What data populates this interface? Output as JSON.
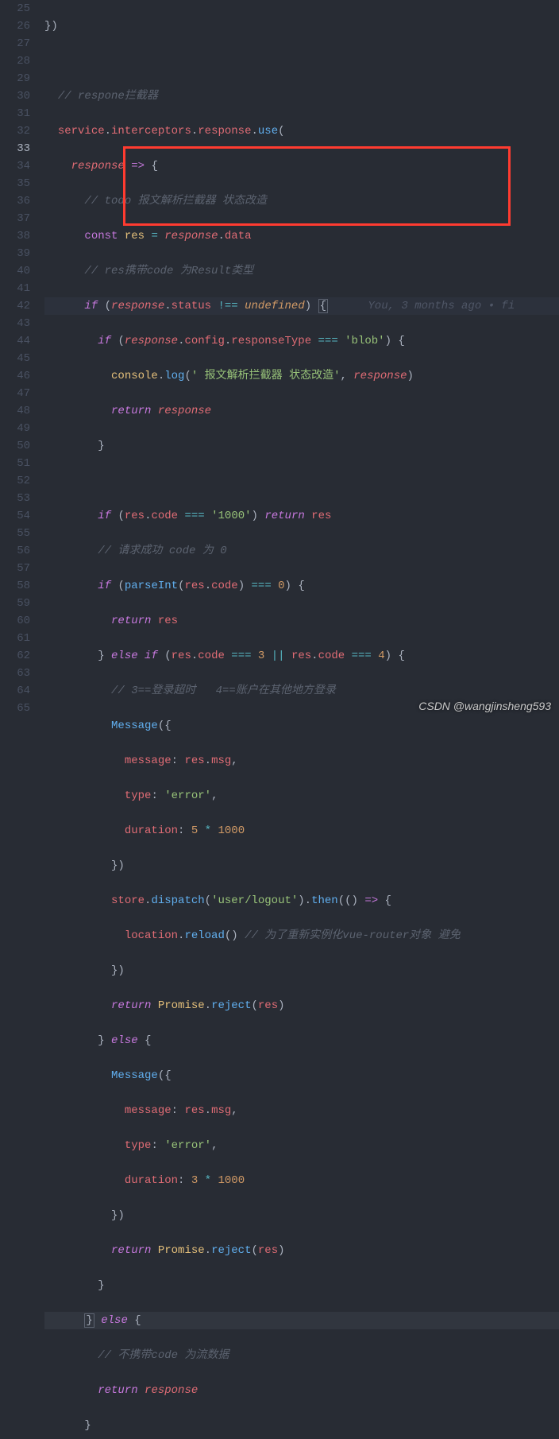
{
  "editor": {
    "first_line": 25,
    "last_line": 65,
    "active_line": 33,
    "blame_33": "You, 3 months ago • fi",
    "watermark": "CSDN @wangjinsheng593"
  },
  "code": {
    "l25": "})",
    "l27_comment": "// respone拦截器",
    "l28_service": "service",
    "l28_interceptors": "interceptors",
    "l28_response": "response",
    "l28_use": "use",
    "l29_response": "response",
    "l30_comment": "// todo 报文解析拦截器 状态改造",
    "l31_const": "const",
    "l31_res": "res",
    "l31_response": "response",
    "l31_data": "data",
    "l32_comment": "// res携带code 为Result类型",
    "l33_response": "response",
    "l33_status": "status",
    "l33_undefined": "undefined",
    "l34_response": "response",
    "l34_config": "config",
    "l34_responseType": "responseType",
    "l34_blob": "'blob'",
    "l35_console": "console",
    "l35_log": "log",
    "l35_str": "' 报文解析拦截器 状态改造'",
    "l35_response": "response",
    "l36_return": "return",
    "l36_response": "response",
    "l37_brace": "}",
    "l39_res": "res",
    "l39_code": "code",
    "l39_1000": "'1000'",
    "l39_return": "return",
    "l39_res2": "res",
    "l40_comment": "// 请求成功 code 为 0",
    "l41_parseInt": "parseInt",
    "l41_res": "res",
    "l41_code": "code",
    "l41_zero": "0",
    "l42_return": "return",
    "l42_res": "res",
    "l43_else_if": "else if",
    "l43_res": "res",
    "l43_code": "code",
    "l43_3": "3",
    "l43_res2": "res",
    "l43_code2": "code",
    "l43_4": "4",
    "l44_comment": "// 3==登录超时   4==账户在其他地方登录",
    "l45_Message": "Message",
    "l46_message": "message",
    "l46_res": "res",
    "l46_msg": "msg",
    "l47_type": "type",
    "l47_error": "'error'",
    "l48_duration": "duration",
    "l48_5": "5",
    "l48_1000": "1000",
    "l50_store": "store",
    "l50_dispatch": "dispatch",
    "l50_userlogout": "'user/logout'",
    "l50_then": "then",
    "l51_location": "location",
    "l51_reload": "reload",
    "l51_comment": "// 为了重新实例化vue-router对象 避免",
    "l53_return": "return",
    "l53_Promise": "Promise",
    "l53_reject": "reject",
    "l53_res": "res",
    "l54_else": "else",
    "l55_Message": "Message",
    "l56_message": "message",
    "l56_res": "res",
    "l56_msg": "msg",
    "l57_type": "type",
    "l57_error": "'error'",
    "l58_duration": "duration",
    "l58_3": "3",
    "l58_1000": "1000",
    "l60_return": "return",
    "l60_Promise": "Promise",
    "l60_reject": "reject",
    "l60_res": "res",
    "l62_else": "else",
    "l63_comment": "// 不携带code 为流数据",
    "l64_return": "return",
    "l64_response": "response"
  }
}
